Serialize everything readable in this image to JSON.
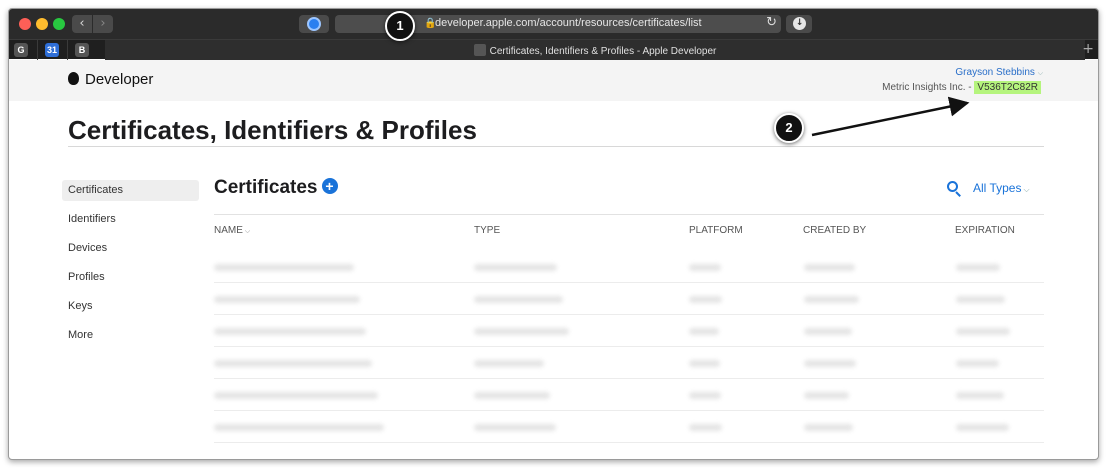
{
  "browser": {
    "url": "developer.apple.com/account/resources/certificates/list",
    "tab_title": "Certificates, Identifiers & Profiles - Apple Developer",
    "pinned_tabs": [
      "G",
      "31",
      "B"
    ],
    "new_tab_glyph": "+"
  },
  "header": {
    "brand": "Developer",
    "user_name": "Grayson Stebbins",
    "team_prefix": "Metric Insights Inc. - ",
    "team_id": "V536T2C82R"
  },
  "page_title": "Certificates, Identifiers & Profiles",
  "sidebar": {
    "items": [
      {
        "label": "Certificates",
        "active": true
      },
      {
        "label": "Identifiers"
      },
      {
        "label": "Devices"
      },
      {
        "label": "Profiles"
      },
      {
        "label": "Keys"
      },
      {
        "label": "More"
      }
    ]
  },
  "content": {
    "section_title": "Certificates",
    "add_glyph": "+",
    "filter_label": "All Types",
    "columns": [
      "NAME",
      "TYPE",
      "PLATFORM",
      "CREATED BY",
      "EXPIRATION"
    ],
    "row_count": 6
  },
  "annotations": [
    "1",
    "2"
  ],
  "colors": {
    "accent": "#1a73d9",
    "team_id_highlight": "#b5f47d",
    "titlebar": "#2b2b2b"
  }
}
